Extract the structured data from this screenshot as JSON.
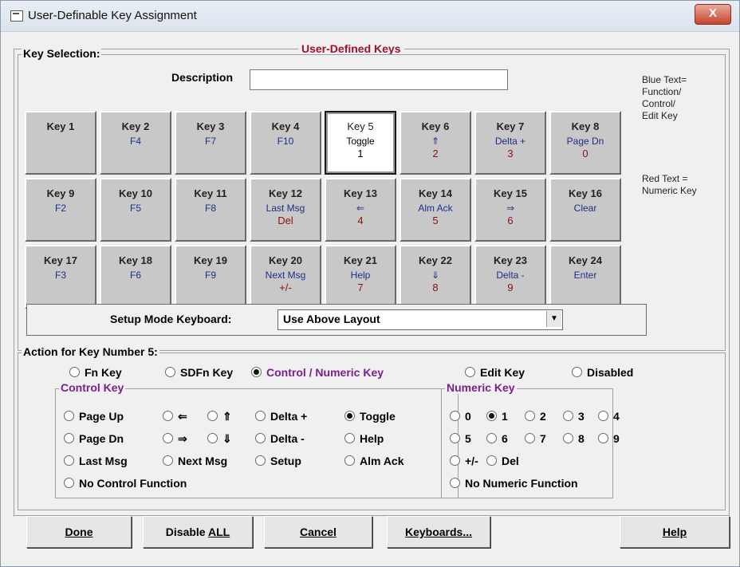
{
  "window": {
    "title": "User-Definable Key Assignment",
    "close_label": "X"
  },
  "main": {
    "group_title": "User-Defined Keys",
    "key_selection_title": "Key Selection:",
    "description_label": "Description",
    "description_value": "",
    "keys": [
      {
        "name": "Key 1",
        "func": "",
        "num": ""
      },
      {
        "name": "Key 2",
        "func": "F4",
        "num": ""
      },
      {
        "name": "Key 3",
        "func": "F7",
        "num": ""
      },
      {
        "name": "Key 4",
        "func": "F10",
        "num": ""
      },
      {
        "name": "Key 5",
        "func": "Toggle",
        "num": "1"
      },
      {
        "name": "Key 6",
        "func": "⇑",
        "num": "2"
      },
      {
        "name": "Key 7",
        "func": "Delta +",
        "num": "3"
      },
      {
        "name": "Key 8",
        "func": "Page Dn",
        "num": "0"
      },
      {
        "name": "Key 9",
        "func": "F2",
        "num": ""
      },
      {
        "name": "Key 10",
        "func": "F5",
        "num": ""
      },
      {
        "name": "Key 11",
        "func": "F8",
        "num": ""
      },
      {
        "name": "Key 12",
        "func": "Last Msg",
        "num": "Del"
      },
      {
        "name": "Key 13",
        "func": "⇐",
        "num": "4"
      },
      {
        "name": "Key 14",
        "func": "Alm Ack",
        "num": "5"
      },
      {
        "name": "Key 15",
        "func": "⇒",
        "num": "6"
      },
      {
        "name": "Key 16",
        "func": "Clear",
        "num": ""
      },
      {
        "name": "Key 17",
        "func": "F3",
        "num": ""
      },
      {
        "name": "Key 18",
        "func": "F6",
        "num": ""
      },
      {
        "name": "Key 19",
        "func": "F9",
        "num": ""
      },
      {
        "name": "Key 20",
        "func": "Next Msg",
        "num": "+/-"
      },
      {
        "name": "Key 21",
        "func": "Help",
        "num": "7"
      },
      {
        "name": "Key 22",
        "func": "⇓",
        "num": "8"
      },
      {
        "name": "Key 23",
        "func": "Delta -",
        "num": "9"
      },
      {
        "name": "Key 24",
        "func": "Enter",
        "num": ""
      }
    ],
    "selected_key": 5,
    "note_blue": "Blue Text=\nFunction/\nControl/\nEdit Key",
    "note_red": "Red Text =\nNumeric Key",
    "setup_label": "Setup Mode Keyboard:",
    "setup_value": "Use Above Layout",
    "action_title": "Action for Key Number 5:",
    "key_types": [
      {
        "label": "Fn Key",
        "checked": false
      },
      {
        "label": "SDFn Key",
        "checked": false
      },
      {
        "label": "Control / Numeric Key",
        "checked": true
      },
      {
        "label": "Edit Key",
        "checked": false
      },
      {
        "label": "Disabled",
        "checked": false
      }
    ],
    "control_title": "Control Key",
    "control_options": [
      {
        "label": "Page Up",
        "checked": false
      },
      {
        "label": "⇐",
        "checked": false
      },
      {
        "label": "⇑",
        "checked": false
      },
      {
        "label": "Delta +",
        "checked": false
      },
      {
        "label": "Toggle",
        "checked": true
      },
      {
        "label": "Page Dn",
        "checked": false
      },
      {
        "label": "⇒",
        "checked": false
      },
      {
        "label": "⇓",
        "checked": false
      },
      {
        "label": "Delta -",
        "checked": false
      },
      {
        "label": "Help",
        "checked": false
      },
      {
        "label": "Last Msg",
        "checked": false
      },
      {
        "label": "Next Msg",
        "checked": false
      },
      {
        "label": "Setup",
        "checked": false
      },
      {
        "label": "Alm Ack",
        "checked": false
      },
      {
        "label": "No Control Function",
        "checked": false
      }
    ],
    "numeric_title": "Numeric Key",
    "numeric_options": [
      {
        "label": "0",
        "checked": false
      },
      {
        "label": "1",
        "checked": true
      },
      {
        "label": "2",
        "checked": false
      },
      {
        "label": "3",
        "checked": false
      },
      {
        "label": "4",
        "checked": false
      },
      {
        "label": "5",
        "checked": false
      },
      {
        "label": "6",
        "checked": false
      },
      {
        "label": "7",
        "checked": false
      },
      {
        "label": "8",
        "checked": false
      },
      {
        "label": "9",
        "checked": false
      },
      {
        "label": "+/-",
        "checked": false
      },
      {
        "label": "Del",
        "checked": false
      },
      {
        "label": "No Numeric Function",
        "checked": false
      }
    ]
  },
  "buttons": {
    "done": "Done",
    "disable_all_pre": "Disable ",
    "disable_all_ul": "ALL",
    "cancel": "Cancel",
    "keyboards": "Keyboards...",
    "help": "Help"
  }
}
